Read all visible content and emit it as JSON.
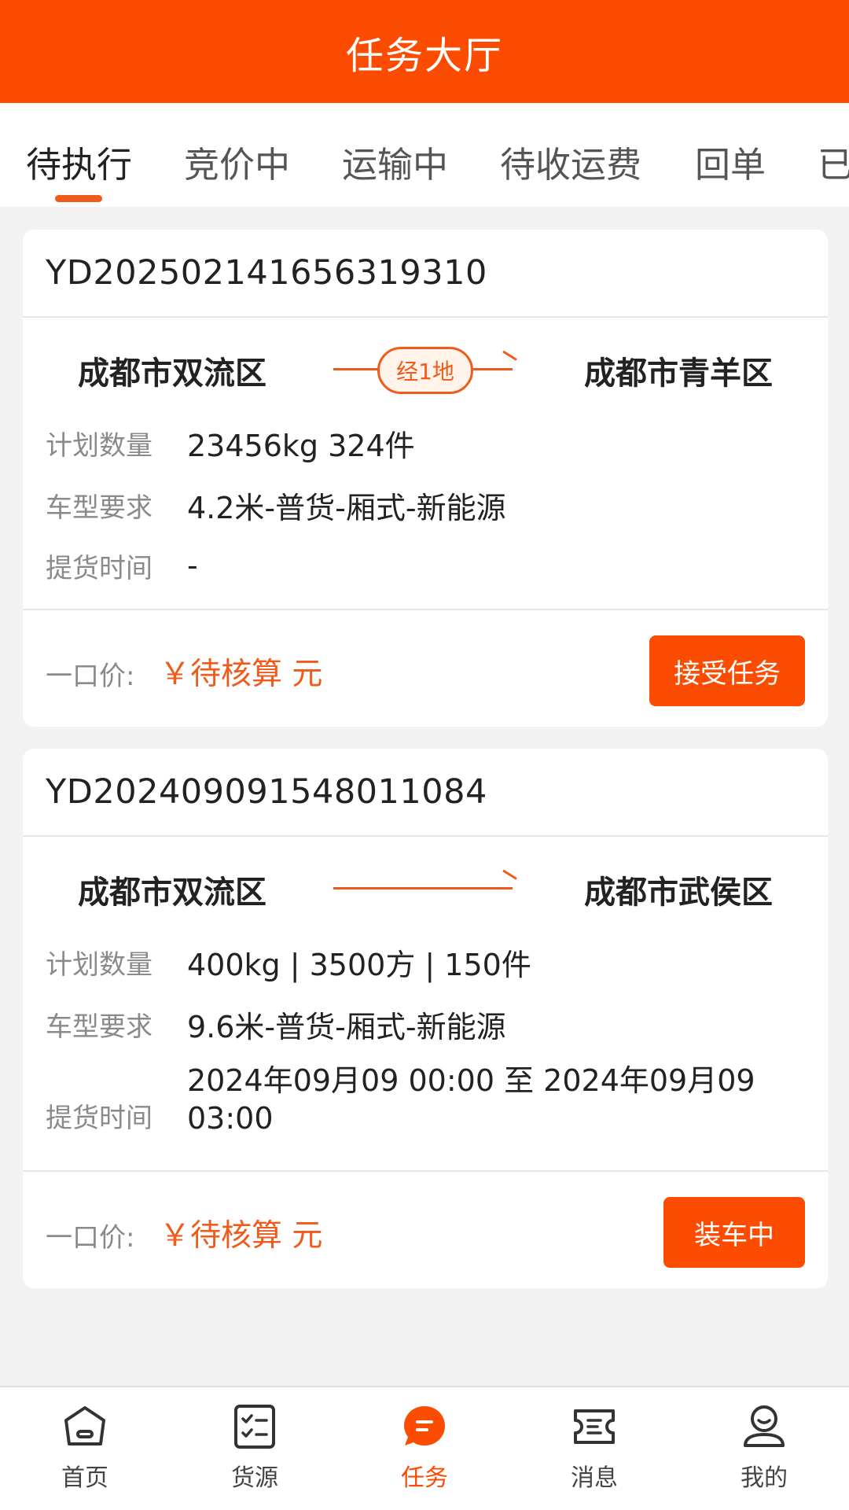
{
  "header": {
    "title": "任务大厅"
  },
  "tabs": [
    {
      "label": "待执行",
      "active": true
    },
    {
      "label": "竞价中"
    },
    {
      "label": "运输中"
    },
    {
      "label": "待收运费"
    },
    {
      "label": "回单"
    },
    {
      "label": "已"
    }
  ],
  "orders": [
    {
      "order_no": "YD20250214165631931​0",
      "from": "成都市双流区",
      "via": "经1地",
      "to": "成都市青羊区",
      "quantity_label": "计划数量",
      "quantity": "23456kg 324件",
      "vehicle_label": "车型要求",
      "vehicle": "4.2米-普货-厢式-新能源",
      "pickup_label": "提货时间",
      "pickup": "-",
      "price_label": "一口价:",
      "price": "￥待核算 元",
      "action": "接受任务"
    },
    {
      "order_no": "YD20240909154801108​4",
      "from": "成都市双流区",
      "via": "",
      "to": "成都市武侯区",
      "quantity_label": "计划数量",
      "quantity": "400kg | 3500方 | 150件",
      "vehicle_label": "车型要求",
      "vehicle": "9.6米-普货-厢式-新能源",
      "pickup_label": "提货时间",
      "pickup_line1": "2024年09月09 00:00 至 2024年09月09",
      "pickup_line2": "03:00",
      "price_label": "一口价:",
      "price": "￥待核算 元",
      "action": "装车中"
    }
  ],
  "bottom_nav": [
    {
      "label": "首页",
      "icon": "home-icon"
    },
    {
      "label": "货源",
      "icon": "cargo-list-icon"
    },
    {
      "label": "任务",
      "icon": "task-chat-icon",
      "active": true
    },
    {
      "label": "消息",
      "icon": "message-ticket-icon"
    },
    {
      "label": "我的",
      "icon": "profile-icon"
    }
  ],
  "colors": {
    "brand": "#fc4c02",
    "accent": "#f05a1a"
  }
}
